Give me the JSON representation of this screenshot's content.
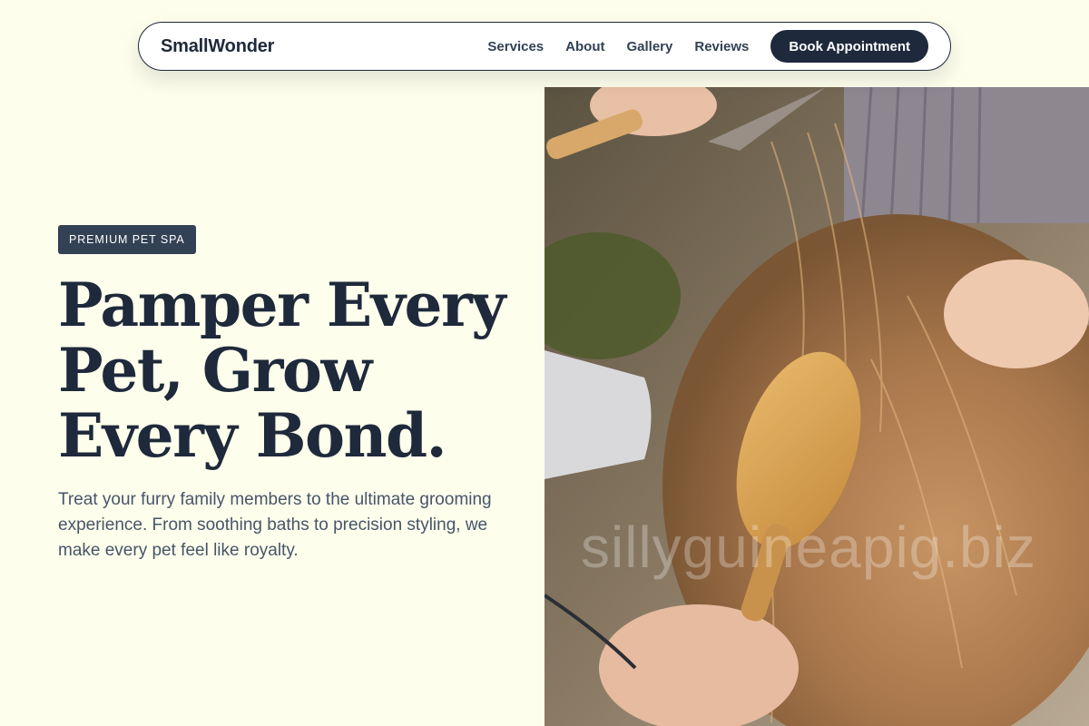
{
  "nav": {
    "brand": "SmallWonder",
    "links": [
      "Services",
      "About",
      "Gallery",
      "Reviews"
    ],
    "cta_label": "Book Appointment"
  },
  "hero": {
    "badge": "PREMIUM PET SPA",
    "headline": "Pamper Every Pet, Grow Every Bond.",
    "lead": "Treat your furry family members to the ultimate grooming experience. From soothing baths to precision styling, we make every pet feel like royalty.",
    "image_watermark": "sillyguineapig.biz"
  },
  "colors": {
    "background": "#fefeec",
    "primary": "#1e293b",
    "badge": "#334155",
    "text_muted": "#475569"
  }
}
